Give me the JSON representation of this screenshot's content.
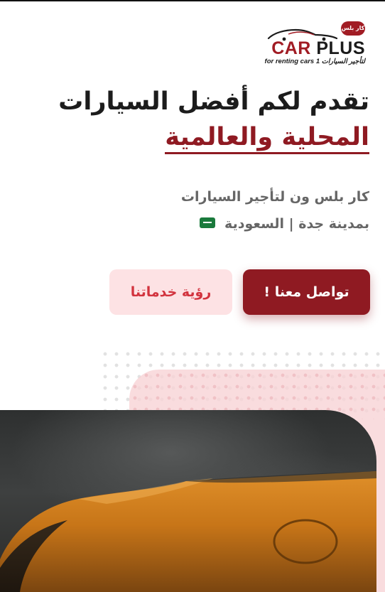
{
  "logo": {
    "badge_text": "كار بلس 1",
    "brand_car": "CAR",
    "brand_plus": "PLUS",
    "tagline": "for renting cars 1 لتأجير السيارات"
  },
  "headline": {
    "line1": "تقدم لكم أفضل السيارات",
    "line2": "المحلية والعالمية"
  },
  "subtitle": {
    "line1": "كار بلس ون لتأجير السيارات",
    "line2": "بمدينة جدة | السعودية"
  },
  "buttons": {
    "contact_label": "تواصل معنا !",
    "services_label": "رؤية خدماتنا"
  },
  "icons": {
    "flag": "saudi-flag-icon",
    "logo_car": "car-silhouette-icon"
  },
  "colors": {
    "brand_red": "#8f1a22",
    "light_pink": "#fde2e4",
    "accent_pink_text": "#d2333e",
    "dark_text": "#1c1c1c",
    "grey_text": "#666666"
  }
}
